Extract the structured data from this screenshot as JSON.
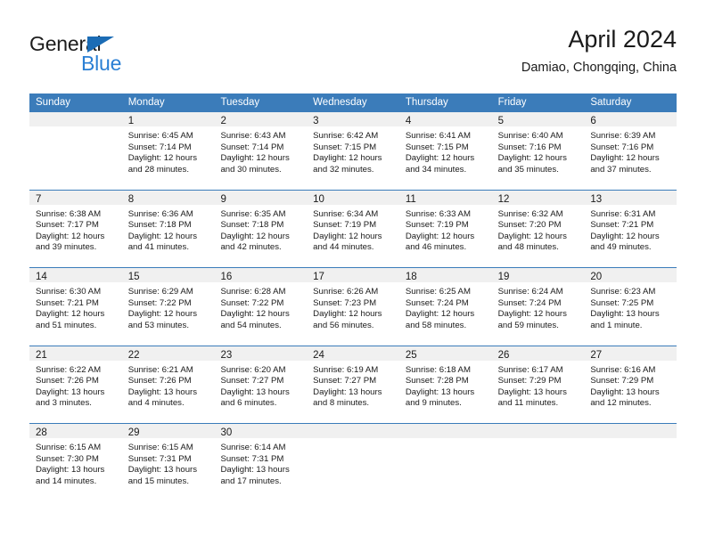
{
  "logo": {
    "word_top": "General",
    "word_bottom": "Blue",
    "triangle_color": "#1b6cb5",
    "blue_color": "#2a7fd4"
  },
  "header": {
    "title": "April 2024",
    "subtitle": "Damiao, Chongqing, China"
  },
  "theme": {
    "header_bg": "#3b7cba",
    "header_text": "#ffffff",
    "daynum_band_bg": "#f0f0f0",
    "row_divider": "#3b7cba",
    "body_text": "#1a1a1a"
  },
  "weekday_headers": [
    "Sunday",
    "Monday",
    "Tuesday",
    "Wednesday",
    "Thursday",
    "Friday",
    "Saturday"
  ],
  "weeks": [
    [
      {
        "day": "",
        "lines": [
          "",
          "",
          "",
          ""
        ]
      },
      {
        "day": "1",
        "lines": [
          "Sunrise: 6:45 AM",
          "Sunset: 7:14 PM",
          "Daylight: 12 hours",
          "and 28 minutes."
        ]
      },
      {
        "day": "2",
        "lines": [
          "Sunrise: 6:43 AM",
          "Sunset: 7:14 PM",
          "Daylight: 12 hours",
          "and 30 minutes."
        ]
      },
      {
        "day": "3",
        "lines": [
          "Sunrise: 6:42 AM",
          "Sunset: 7:15 PM",
          "Daylight: 12 hours",
          "and 32 minutes."
        ]
      },
      {
        "day": "4",
        "lines": [
          "Sunrise: 6:41 AM",
          "Sunset: 7:15 PM",
          "Daylight: 12 hours",
          "and 34 minutes."
        ]
      },
      {
        "day": "5",
        "lines": [
          "Sunrise: 6:40 AM",
          "Sunset: 7:16 PM",
          "Daylight: 12 hours",
          "and 35 minutes."
        ]
      },
      {
        "day": "6",
        "lines": [
          "Sunrise: 6:39 AM",
          "Sunset: 7:16 PM",
          "Daylight: 12 hours",
          "and 37 minutes."
        ]
      }
    ],
    [
      {
        "day": "7",
        "lines": [
          "Sunrise: 6:38 AM",
          "Sunset: 7:17 PM",
          "Daylight: 12 hours",
          "and 39 minutes."
        ]
      },
      {
        "day": "8",
        "lines": [
          "Sunrise: 6:36 AM",
          "Sunset: 7:18 PM",
          "Daylight: 12 hours",
          "and 41 minutes."
        ]
      },
      {
        "day": "9",
        "lines": [
          "Sunrise: 6:35 AM",
          "Sunset: 7:18 PM",
          "Daylight: 12 hours",
          "and 42 minutes."
        ]
      },
      {
        "day": "10",
        "lines": [
          "Sunrise: 6:34 AM",
          "Sunset: 7:19 PM",
          "Daylight: 12 hours",
          "and 44 minutes."
        ]
      },
      {
        "day": "11",
        "lines": [
          "Sunrise: 6:33 AM",
          "Sunset: 7:19 PM",
          "Daylight: 12 hours",
          "and 46 minutes."
        ]
      },
      {
        "day": "12",
        "lines": [
          "Sunrise: 6:32 AM",
          "Sunset: 7:20 PM",
          "Daylight: 12 hours",
          "and 48 minutes."
        ]
      },
      {
        "day": "13",
        "lines": [
          "Sunrise: 6:31 AM",
          "Sunset: 7:21 PM",
          "Daylight: 12 hours",
          "and 49 minutes."
        ]
      }
    ],
    [
      {
        "day": "14",
        "lines": [
          "Sunrise: 6:30 AM",
          "Sunset: 7:21 PM",
          "Daylight: 12 hours",
          "and 51 minutes."
        ]
      },
      {
        "day": "15",
        "lines": [
          "Sunrise: 6:29 AM",
          "Sunset: 7:22 PM",
          "Daylight: 12 hours",
          "and 53 minutes."
        ]
      },
      {
        "day": "16",
        "lines": [
          "Sunrise: 6:28 AM",
          "Sunset: 7:22 PM",
          "Daylight: 12 hours",
          "and 54 minutes."
        ]
      },
      {
        "day": "17",
        "lines": [
          "Sunrise: 6:26 AM",
          "Sunset: 7:23 PM",
          "Daylight: 12 hours",
          "and 56 minutes."
        ]
      },
      {
        "day": "18",
        "lines": [
          "Sunrise: 6:25 AM",
          "Sunset: 7:24 PM",
          "Daylight: 12 hours",
          "and 58 minutes."
        ]
      },
      {
        "day": "19",
        "lines": [
          "Sunrise: 6:24 AM",
          "Sunset: 7:24 PM",
          "Daylight: 12 hours",
          "and 59 minutes."
        ]
      },
      {
        "day": "20",
        "lines": [
          "Sunrise: 6:23 AM",
          "Sunset: 7:25 PM",
          "Daylight: 13 hours",
          "and 1 minute."
        ]
      }
    ],
    [
      {
        "day": "21",
        "lines": [
          "Sunrise: 6:22 AM",
          "Sunset: 7:26 PM",
          "Daylight: 13 hours",
          "and 3 minutes."
        ]
      },
      {
        "day": "22",
        "lines": [
          "Sunrise: 6:21 AM",
          "Sunset: 7:26 PM",
          "Daylight: 13 hours",
          "and 4 minutes."
        ]
      },
      {
        "day": "23",
        "lines": [
          "Sunrise: 6:20 AM",
          "Sunset: 7:27 PM",
          "Daylight: 13 hours",
          "and 6 minutes."
        ]
      },
      {
        "day": "24",
        "lines": [
          "Sunrise: 6:19 AM",
          "Sunset: 7:27 PM",
          "Daylight: 13 hours",
          "and 8 minutes."
        ]
      },
      {
        "day": "25",
        "lines": [
          "Sunrise: 6:18 AM",
          "Sunset: 7:28 PM",
          "Daylight: 13 hours",
          "and 9 minutes."
        ]
      },
      {
        "day": "26",
        "lines": [
          "Sunrise: 6:17 AM",
          "Sunset: 7:29 PM",
          "Daylight: 13 hours",
          "and 11 minutes."
        ]
      },
      {
        "day": "27",
        "lines": [
          "Sunrise: 6:16 AM",
          "Sunset: 7:29 PM",
          "Daylight: 13 hours",
          "and 12 minutes."
        ]
      }
    ],
    [
      {
        "day": "28",
        "lines": [
          "Sunrise: 6:15 AM",
          "Sunset: 7:30 PM",
          "Daylight: 13 hours",
          "and 14 minutes."
        ]
      },
      {
        "day": "29",
        "lines": [
          "Sunrise: 6:15 AM",
          "Sunset: 7:31 PM",
          "Daylight: 13 hours",
          "and 15 minutes."
        ]
      },
      {
        "day": "30",
        "lines": [
          "Sunrise: 6:14 AM",
          "Sunset: 7:31 PM",
          "Daylight: 13 hours",
          "and 17 minutes."
        ]
      },
      {
        "day": "",
        "lines": [
          "",
          "",
          "",
          ""
        ]
      },
      {
        "day": "",
        "lines": [
          "",
          "",
          "",
          ""
        ]
      },
      {
        "day": "",
        "lines": [
          "",
          "",
          "",
          ""
        ]
      },
      {
        "day": "",
        "lines": [
          "",
          "",
          "",
          ""
        ]
      }
    ]
  ]
}
